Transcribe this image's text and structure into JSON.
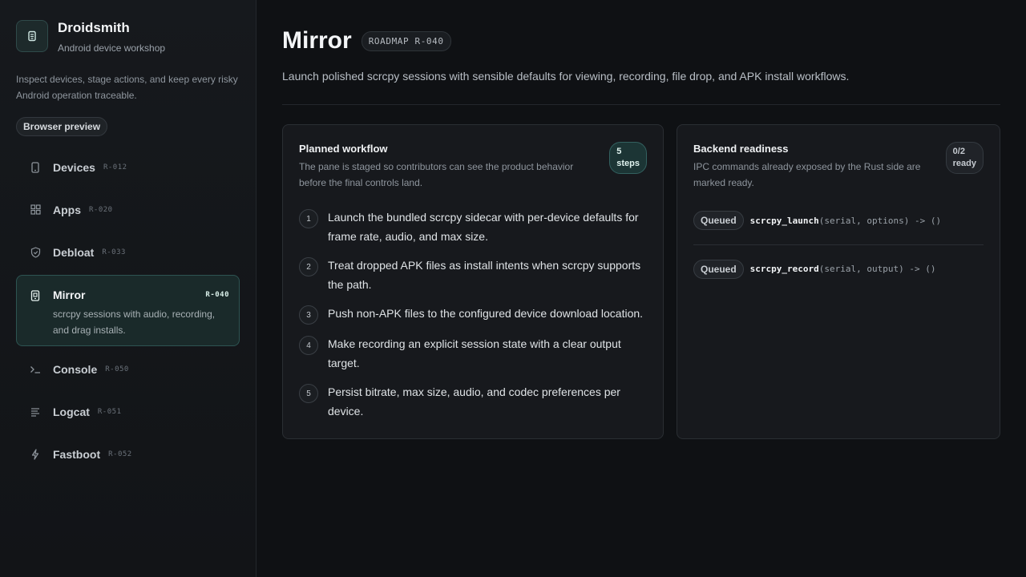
{
  "brand": {
    "name": "Droidsmith",
    "subtitle": "Android device workshop",
    "intro": "Inspect devices, stage actions, and keep every risky Android operation traceable.",
    "preview_label": "Browser preview"
  },
  "nav": {
    "devices": {
      "label": "Devices",
      "code": "R-012",
      "icon": "phone-icon"
    },
    "apps": {
      "label": "Apps",
      "code": "R-020",
      "icon": "grid-icon"
    },
    "debloat": {
      "label": "Debloat",
      "code": "R-033",
      "icon": "shield-icon"
    },
    "mirror": {
      "label": "Mirror",
      "code": "R-040",
      "icon": "mirror-icon",
      "description": "scrcpy sessions with audio, recording, and drag installs."
    },
    "console": {
      "label": "Console",
      "code": "R-050",
      "icon": "terminal-icon"
    },
    "logcat": {
      "label": "Logcat",
      "code": "R-051",
      "icon": "lines-icon"
    },
    "fastboot": {
      "label": "Fastboot",
      "code": "R-052",
      "icon": "bolt-icon"
    }
  },
  "header": {
    "title": "Mirror",
    "roadmap": "ROADMAP R-040",
    "description": "Launch polished scrcpy sessions with sensible defaults for viewing, recording, file drop, and APK install workflows."
  },
  "workflow": {
    "title": "Planned workflow",
    "subtitle": "The pane is staged so contributors can see the product behavior before the final controls land.",
    "badge_count": "5",
    "badge_unit": "steps",
    "steps": [
      {
        "num": "1",
        "text": "Launch the bundled scrcpy sidecar with per-device defaults for frame rate, audio, and max size."
      },
      {
        "num": "2",
        "text": "Treat dropped APK files as install intents when scrcpy supports the path."
      },
      {
        "num": "3",
        "text": "Push non-APK files to the configured device download location."
      },
      {
        "num": "4",
        "text": "Make recording an explicit session state with a clear output target."
      },
      {
        "num": "5",
        "text": "Persist bitrate, max size, audio, and codec preferences per device."
      }
    ]
  },
  "backend": {
    "title": "Backend readiness",
    "subtitle": "IPC commands already exposed by the Rust side are marked ready.",
    "badge_count": "0/2",
    "badge_unit": "ready",
    "commands": [
      {
        "status": "Queued",
        "fn": "scrcpy_launch",
        "sig": "(serial, options) -> ()"
      },
      {
        "status": "Queued",
        "fn": "scrcpy_record",
        "sig": "(serial, output) -> ()"
      }
    ]
  },
  "colors": {
    "accent": "#2d5452",
    "background": "#0f1114",
    "card": "#17191d"
  }
}
